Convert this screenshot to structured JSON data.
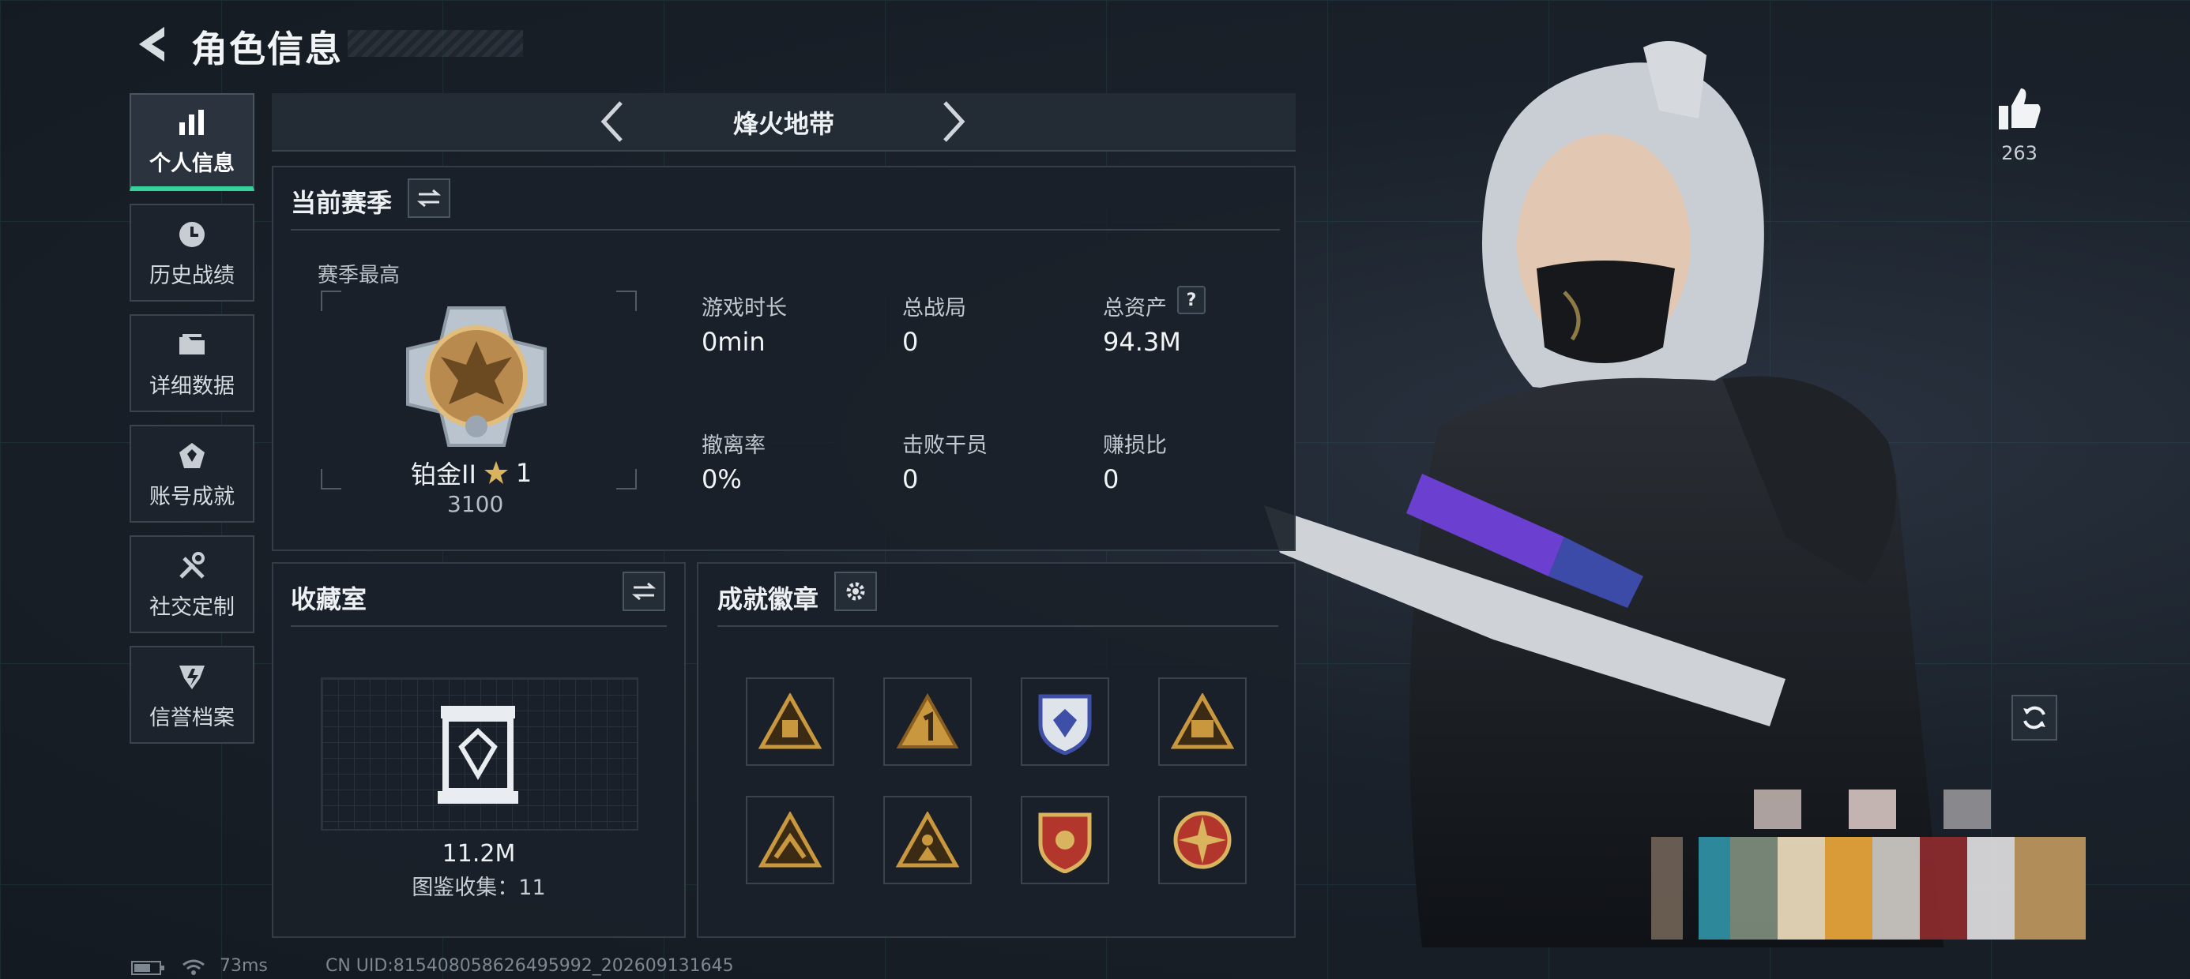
{
  "header": {
    "title": "角色信息"
  },
  "sidebar": {
    "items": [
      {
        "label": "个人信息",
        "icon": "bar-chart-icon"
      },
      {
        "label": "历史战绩",
        "icon": "clock-icon"
      },
      {
        "label": "详细数据",
        "icon": "folder-icon"
      },
      {
        "label": "账号成就",
        "icon": "medal-icon"
      },
      {
        "label": "社交定制",
        "icon": "tools-icon"
      },
      {
        "label": "信誉档案",
        "icon": "shield-icon"
      }
    ]
  },
  "mode": {
    "name": "烽火地带"
  },
  "season": {
    "title": "当前赛季",
    "best_label": "赛季最高",
    "rank_name": "铂金II",
    "rank_stars": "1",
    "rank_score": "3100",
    "stats": [
      {
        "label": "游戏时长",
        "value": "0min"
      },
      {
        "label": "总战局",
        "value": "0"
      },
      {
        "label": "总资产",
        "value": "94.3M"
      },
      {
        "label": "撤离率",
        "value": "0%"
      },
      {
        "label": "击败干员",
        "value": "0"
      },
      {
        "label": "赚损比",
        "value": "0"
      }
    ],
    "help_glyph": "?"
  },
  "collection": {
    "title": "收藏室",
    "value": "11.2M",
    "catalog": "图鉴收集：11"
  },
  "badges": {
    "title": "成就徽章",
    "items": [
      {
        "icon": "triangle-badge-icon",
        "color": "#c9973e"
      },
      {
        "icon": "triangle-one-badge-icon",
        "color": "#c9973e"
      },
      {
        "icon": "police-shield-badge-icon",
        "color": "#3e4fa8"
      },
      {
        "icon": "triangle-58-badge-icon",
        "color": "#c9973e"
      },
      {
        "icon": "triangle-hands-badge-icon",
        "color": "#c9973e"
      },
      {
        "icon": "triangle-soldier-badge-icon",
        "color": "#c9973e"
      },
      {
        "icon": "red-shield-badge-icon",
        "color": "#b2362c"
      },
      {
        "icon": "compass-badge-icon",
        "color": "#b2362c"
      }
    ]
  },
  "likes": {
    "count": "263"
  },
  "status_bar": {
    "ping": "73ms",
    "uid": "CN UID:815408058626495992_202609131645"
  },
  "colors": {
    "accent": "#35d39a",
    "panel_border": "#333c47",
    "gold": "#c9973e"
  }
}
